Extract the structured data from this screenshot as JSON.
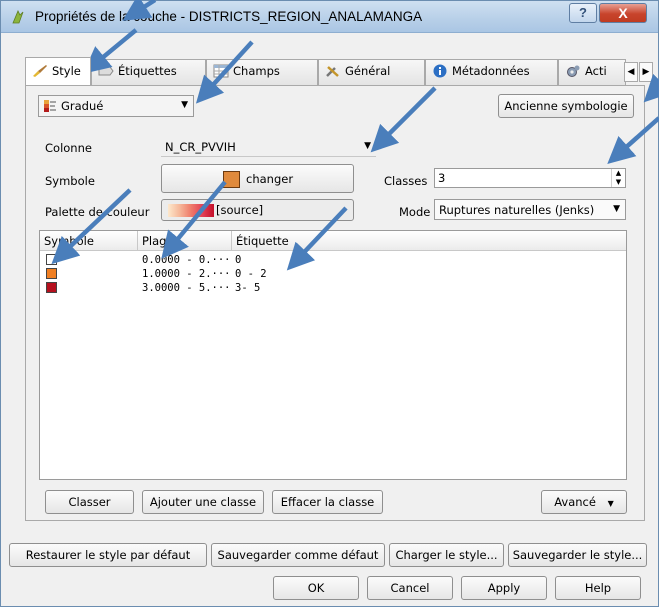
{
  "window": {
    "title": "Propriétés de la couche - DISTRICTS_REGION_ANALAMANGA",
    "help_glyph": "?",
    "close_glyph": "X"
  },
  "tabs": [
    {
      "label": "Style",
      "icon": "style-brush-icon"
    },
    {
      "label": "Étiquettes",
      "icon": "label-icon"
    },
    {
      "label": "Champs",
      "icon": "table-icon"
    },
    {
      "label": "Général",
      "icon": "tools-icon"
    },
    {
      "label": "Métadonnées",
      "icon": "info-icon"
    },
    {
      "label": "Acti",
      "icon": "gear-icon"
    }
  ],
  "style": {
    "renderer_value": "Gradué",
    "old_symbology_label": "Ancienne symbologie",
    "column_label": "Colonne",
    "column_value": "N_CR_PVVIH",
    "symbol_label": "Symbole",
    "symbol_button_label": "changer",
    "symbol_color": "#e08a3c",
    "classes_label": "Classes",
    "classes_value": "3",
    "palette_label": "Palette de couleur",
    "palette_value": "[source]",
    "mode_label": "Mode",
    "mode_value": "Ruptures naturelles (Jenks)"
  },
  "table": {
    "headers": [
      "Symbole",
      "Plage",
      "Étiquette"
    ],
    "rows": [
      {
        "color": "#ffffff",
        "range": "0.0000 - 0.···",
        "label": "0"
      },
      {
        "color": "#f07f22",
        "range": "1.0000 - 2.···",
        "label": "0 - 2"
      },
      {
        "color": "#b5101e",
        "range": "3.0000 - 5.···",
        "label": "3- 5"
      }
    ]
  },
  "panel_buttons": {
    "classify": "Classer",
    "add_class": "Ajouter une classe",
    "delete_class": "Effacer la classe",
    "advanced": "Avancé"
  },
  "style_buttons": {
    "restore_default": "Restaurer le style par défaut",
    "save_default": "Sauvegarder comme défaut",
    "load_style": "Charger le style...",
    "save_style": "Sauvegarder le style..."
  },
  "dialog_buttons": {
    "ok": "OK",
    "cancel": "Cancel",
    "apply": "Apply",
    "help": "Help"
  },
  "annotation_color": "#4a7ebb"
}
